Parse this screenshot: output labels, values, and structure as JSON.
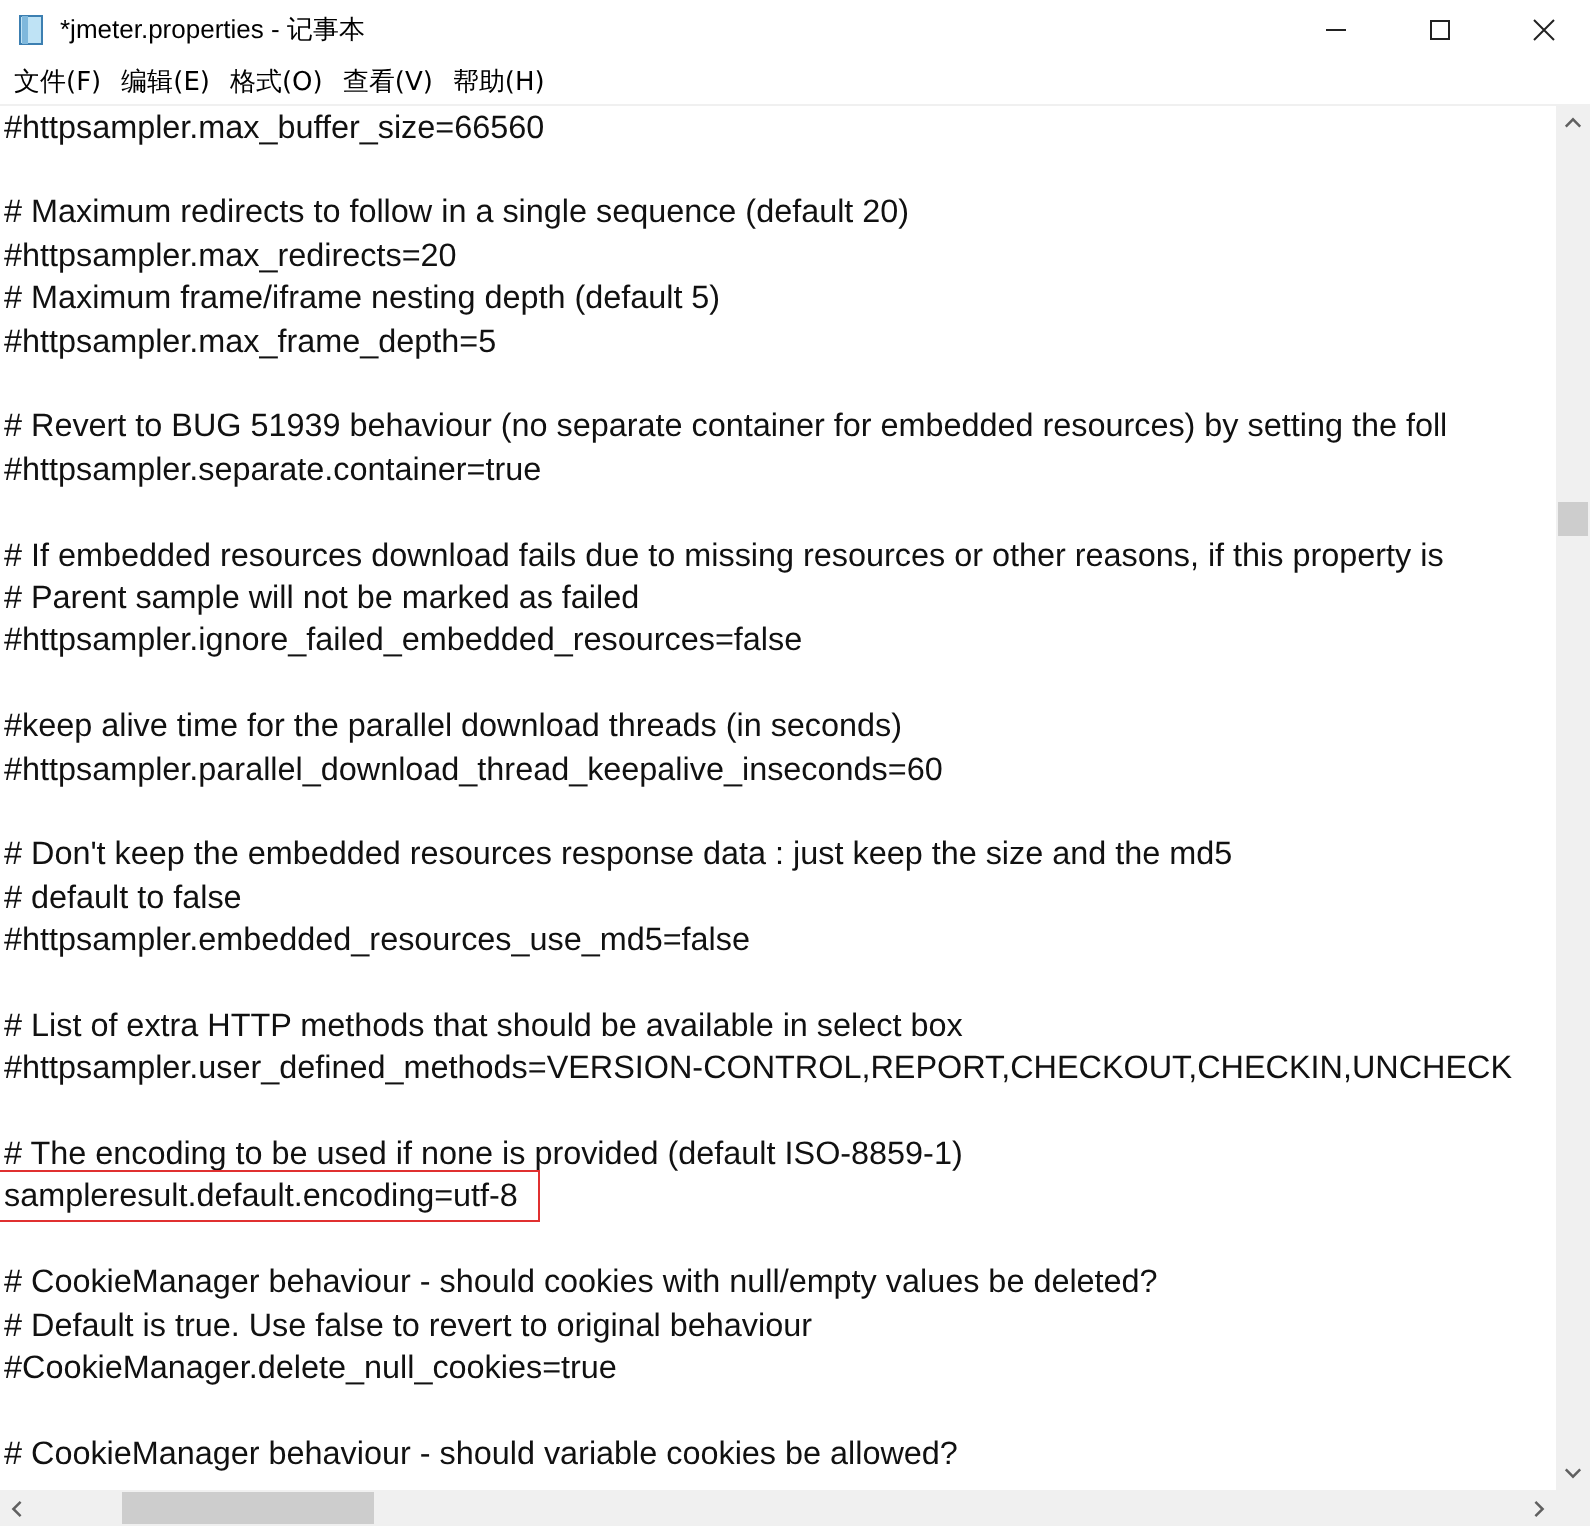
{
  "window": {
    "title": "*jmeter.properties - 记事本"
  },
  "menu": [
    "文件(F)",
    "编辑(E)",
    "格式(O)",
    "查看(V)",
    "帮助(H)"
  ],
  "lines": [
    {
      "kind": "text",
      "text": "#httpsampler.max_buffer_size=66560",
      "boxed": false
    },
    {
      "kind": "blank"
    },
    {
      "kind": "text",
      "text": "# Maximum redirects to follow in a single sequence (default 20)",
      "boxed": false
    },
    {
      "kind": "text",
      "text": "#httpsampler.max_redirects=20",
      "boxed": false
    },
    {
      "kind": "text",
      "text": "# Maximum frame/iframe nesting depth (default 5)",
      "boxed": false
    },
    {
      "kind": "text",
      "text": "#httpsampler.max_frame_depth=5",
      "boxed": false
    },
    {
      "kind": "blank"
    },
    {
      "kind": "text",
      "text": "# Revert to BUG 51939 behaviour (no separate container for embedded resources) by setting the foll",
      "boxed": false
    },
    {
      "kind": "text",
      "text": "#httpsampler.separate.container=true",
      "boxed": false
    },
    {
      "kind": "blank"
    },
    {
      "kind": "text",
      "text": "# If embedded resources download fails due to missing resources or other reasons, if this property is",
      "boxed": false
    },
    {
      "kind": "text",
      "text": "# Parent sample will not be marked as failed",
      "boxed": false
    },
    {
      "kind": "text",
      "text": "#httpsampler.ignore_failed_embedded_resources=false",
      "boxed": false
    },
    {
      "kind": "blank"
    },
    {
      "kind": "text",
      "text": "#keep alive time for the parallel download threads (in seconds)",
      "boxed": false
    },
    {
      "kind": "text",
      "text": "#httpsampler.parallel_download_thread_keepalive_inseconds=60",
      "boxed": false
    },
    {
      "kind": "blank"
    },
    {
      "kind": "text",
      "text": "# Don't keep the embedded resources response data : just keep the size and the md5",
      "boxed": false
    },
    {
      "kind": "text",
      "text": "# default to false",
      "boxed": false
    },
    {
      "kind": "text",
      "text": "#httpsampler.embedded_resources_use_md5=false",
      "boxed": false
    },
    {
      "kind": "blank"
    },
    {
      "kind": "text",
      "text": "# List of extra HTTP methods that should be available in select box",
      "boxed": false
    },
    {
      "kind": "text",
      "text": "#httpsampler.user_defined_methods=VERSION-CONTROL,REPORT,CHECKOUT,CHECKIN,UNCHECK",
      "boxed": false
    },
    {
      "kind": "blank"
    },
    {
      "kind": "text",
      "text": "# The encoding to be used if none is provided (default ISO-8859-1)",
      "boxed": false
    },
    {
      "kind": "text",
      "text": "sampleresult.default.encoding=utf-8",
      "boxed": true
    },
    {
      "kind": "blank"
    },
    {
      "kind": "text",
      "text": "# CookieManager behaviour - should cookies with null/empty values be deleted?",
      "boxed": false
    },
    {
      "kind": "text",
      "text": "# Default is true. Use false to revert to original behaviour",
      "boxed": false
    },
    {
      "kind": "text",
      "text": "#CookieManager.delete_null_cookies=true",
      "boxed": false
    },
    {
      "kind": "blank"
    },
    {
      "kind": "text",
      "text": "# CookieManager behaviour - should variable cookies be allowed?",
      "boxed": false
    }
  ]
}
